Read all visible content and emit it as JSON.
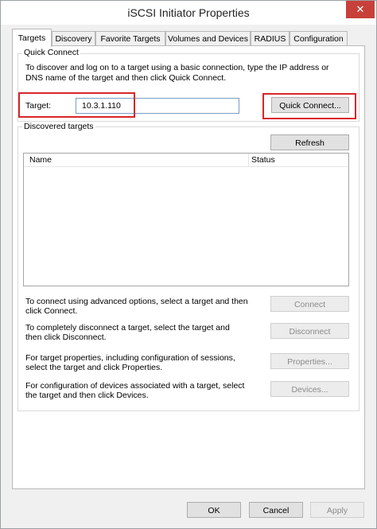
{
  "window": {
    "title": "iSCSI Initiator Properties",
    "close_glyph": "✕"
  },
  "tabs": [
    {
      "label": "Targets",
      "active": true
    },
    {
      "label": "Discovery"
    },
    {
      "label": "Favorite Targets"
    },
    {
      "label": "Volumes and Devices"
    },
    {
      "label": "RADIUS"
    },
    {
      "label": "Configuration"
    }
  ],
  "quick_connect": {
    "group_label": "Quick Connect",
    "description_line1": "To discover and log on to a target using a basic connection, type the IP address or",
    "description_line2": "DNS name of the target and then click Quick Connect.",
    "target_label": "Target:",
    "target_value": "10.3.1.110",
    "button_label": "Quick Connect..."
  },
  "discovered": {
    "group_label": "Discovered targets",
    "refresh_label": "Refresh",
    "columns": [
      "Name",
      "Status"
    ],
    "rows": []
  },
  "actions": [
    {
      "line1": "To connect using advanced options, select a target and then",
      "line2": "click Connect.",
      "button": "Connect"
    },
    {
      "line1": "To completely disconnect a target, select the target and",
      "line2": "then click Disconnect.",
      "button": "Disconnect"
    },
    {
      "line1": "For target properties, including configuration of sessions,",
      "line2": "select the target and click Properties.",
      "button": "Properties..."
    },
    {
      "line1": "For configuration of devices associated with a target, select",
      "line2": "the target and then click Devices.",
      "button": "Devices..."
    }
  ],
  "footer": {
    "ok": "OK",
    "cancel": "Cancel",
    "apply": "Apply"
  },
  "colors": {
    "highlight": "#d9262a",
    "close_button": "#c7413a"
  }
}
